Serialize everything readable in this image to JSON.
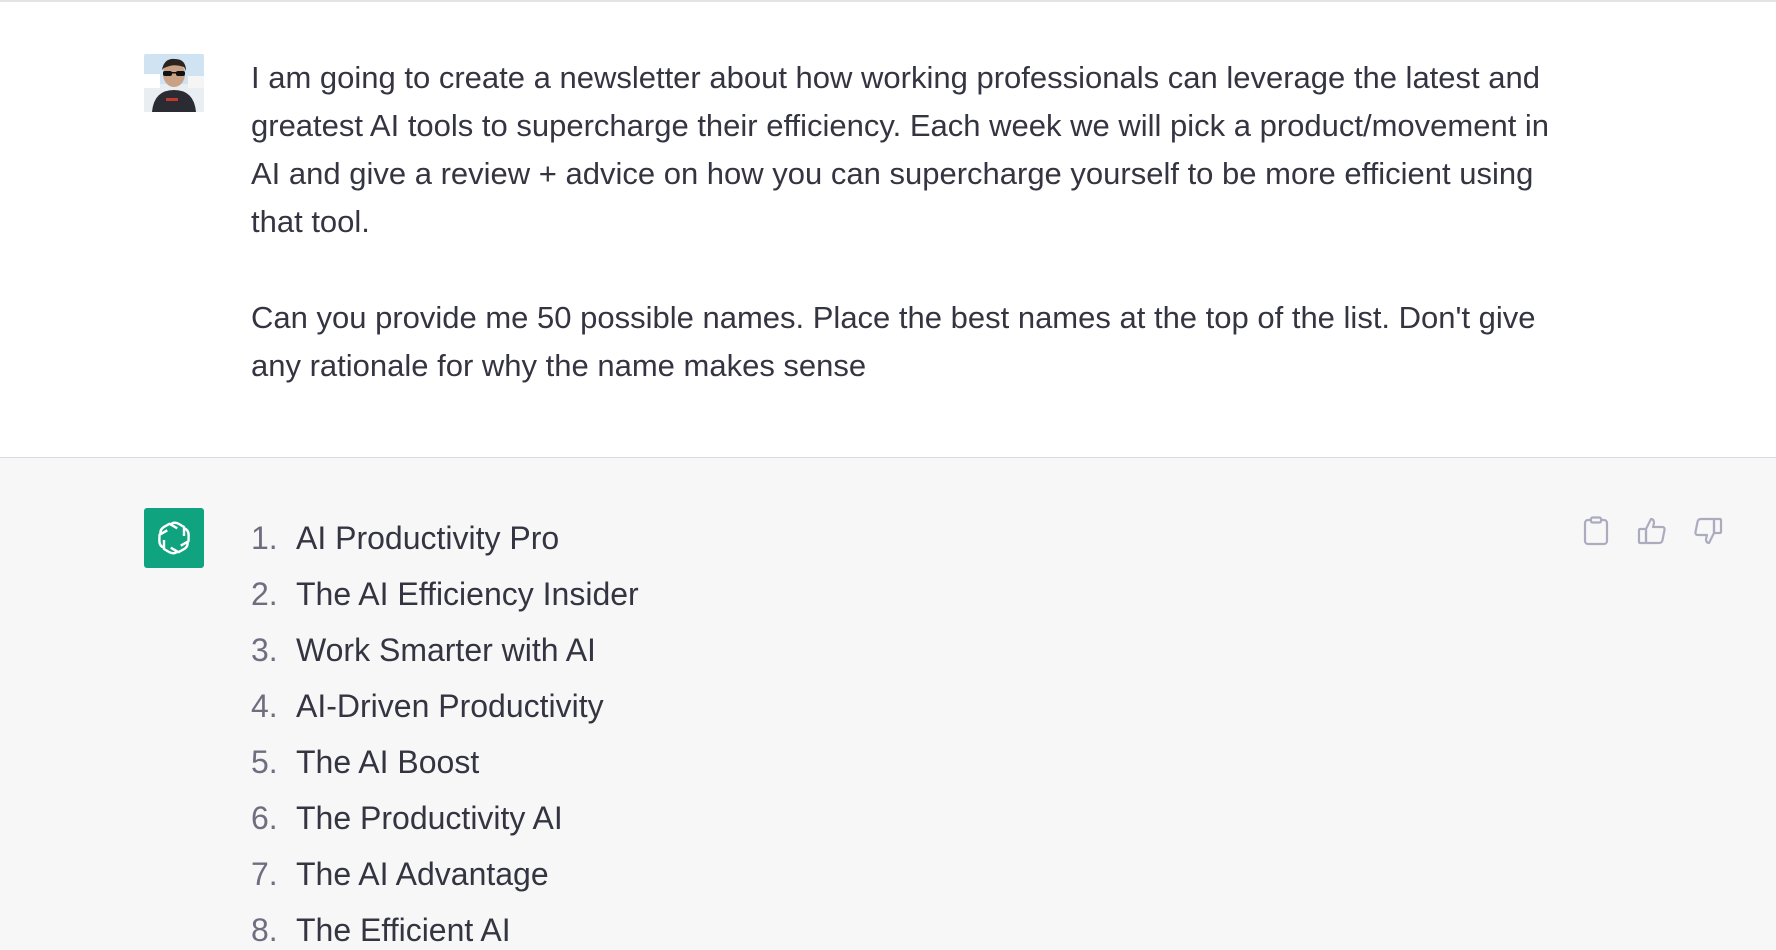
{
  "user_message": {
    "paragraph1": "I am going to create a newsletter about how working professionals can leverage the latest and greatest AI tools to supercharge their efficiency. Each week we will pick a product/movement in AI and give a review + advice on how you can supercharge yourself to be more efficient using that tool.",
    "paragraph2": "Can you provide me 50 possible names. Place the best names at the top of the list. Don't give any rationale for why the name makes sense"
  },
  "assistant_message": {
    "items": [
      {
        "number": "1.",
        "text": "AI Productivity Pro"
      },
      {
        "number": "2.",
        "text": "The AI Efficiency Insider"
      },
      {
        "number": "3.",
        "text": "Work Smarter with AI"
      },
      {
        "number": "4.",
        "text": "AI-Driven Productivity"
      },
      {
        "number": "5.",
        "text": "The AI Boost"
      },
      {
        "number": "6.",
        "text": "The Productivity AI"
      },
      {
        "number": "7.",
        "text": "The AI Advantage"
      },
      {
        "number": "8.",
        "text": "The Efficient AI"
      }
    ]
  },
  "actions": {
    "copy_icon": "clipboard-icon",
    "like_icon": "thumbs-up-icon",
    "dislike_icon": "thumbs-down-icon"
  },
  "colors": {
    "bot_avatar_bg": "#10a37f",
    "assistant_bg": "#f7f7f8",
    "text": "#343541"
  }
}
